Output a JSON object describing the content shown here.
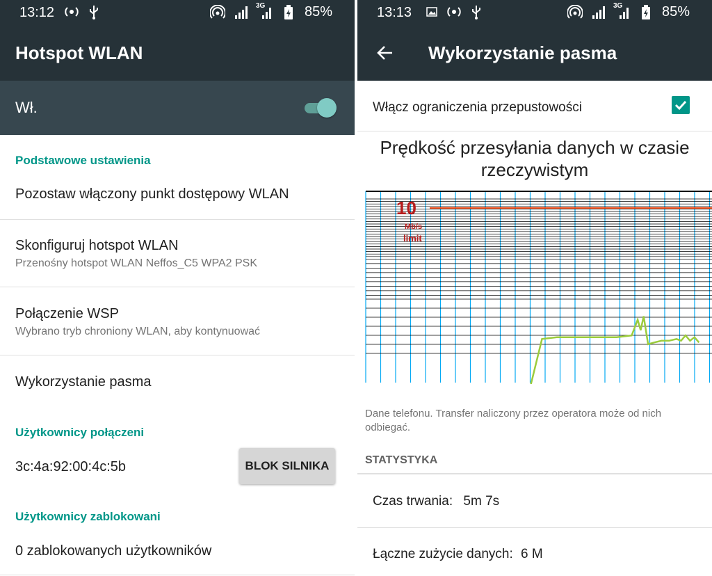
{
  "left": {
    "statusbar": {
      "time": "13:12",
      "battery": "85%",
      "network_badge": "3G"
    },
    "appbar": {
      "title": "Hotspot WLAN"
    },
    "switch_label": "Wł.",
    "sections": {
      "basic": "Podstawowe ustawienia",
      "connected_users": "Użytkownicy połączeni",
      "blocked_users": "Użytkownicy zablokowani"
    },
    "items": {
      "keep_on": "Pozostaw włączony punkt dostępowy WLAN",
      "configure_title": "Skonfiguruj hotspot WLAN",
      "configure_sub": "Przenośny hotspot WLAN Neffos_C5 WPA2 PSK",
      "wps_title": "Połączenie WSP",
      "wps_sub": "Wybrano tryb chroniony WLAN, aby kontynuować",
      "bandwidth": "Wykorzystanie pasma",
      "user_mac": "3c:4a:92:00:4c:5b",
      "block_button": "BLOK SILNIKA",
      "blocked_count": "0 zablokowanych użytkowników"
    }
  },
  "right": {
    "statusbar": {
      "time": "13:13",
      "battery": "85%",
      "network_badge": "3G"
    },
    "appbar": {
      "title": "Wykorzystanie pasma"
    },
    "limit_checkbox_label": "Włącz ograniczenia przepustowości",
    "chart_title_line1": "Prędkość przesyłania danych w czasie",
    "chart_title_line2": "rzeczywistym",
    "chart_limit_value": "10",
    "chart_limit_unit": "Mb/s",
    "chart_limit_word": "limit",
    "note_line1": "Dane telefonu. Transfer naliczony przez operatora może od nich",
    "note_line2": "odbiegać.",
    "stats_heading": "STATYSTYKA",
    "duration_label": "Czas trwania:",
    "duration_value": "5m 7s",
    "total_label": "Łączne zużycie danych:",
    "total_value": "6 M",
    "chart_data": {
      "type": "line",
      "limit": 10,
      "series": [
        {
          "color": "#9ccc3c",
          "points": [
            [
              0,
              -1
            ],
            [
              1,
              2.5
            ],
            [
              2,
              2.6
            ],
            [
              3,
              2.6
            ],
            [
              4,
              2.6
            ],
            [
              5,
              2.6
            ],
            [
              6,
              2.6
            ],
            [
              7,
              2.7
            ],
            [
              7.4,
              3.6
            ],
            [
              7.6,
              3.0
            ],
            [
              7.8,
              3.8
            ],
            [
              8.1,
              2.2
            ],
            [
              8.5,
              2.3
            ],
            [
              9,
              2.4
            ],
            [
              9.5,
              2.4
            ],
            [
              10,
              2.5
            ],
            [
              10.3,
              2.4
            ],
            [
              10.6,
              2.7
            ],
            [
              10.9,
              2.4
            ],
            [
              11.2,
              2.6
            ],
            [
              11.5,
              2.3
            ]
          ]
        }
      ],
      "colors": {
        "limit_line": "#f4511e",
        "limit_text": "#b71c1c",
        "grid_vertical": "#03a9f4",
        "grid_horizontal": "#000000"
      }
    }
  }
}
